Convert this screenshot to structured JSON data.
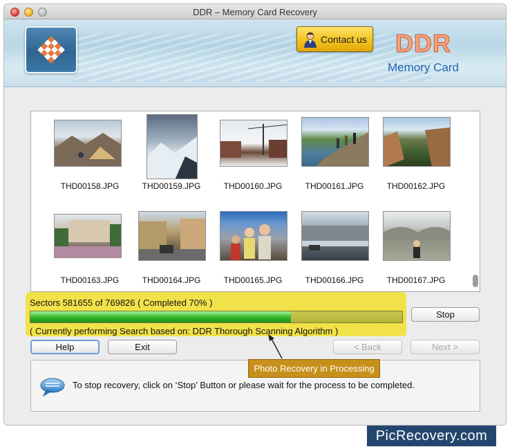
{
  "window": {
    "title": "DDR – Memory Card Recovery"
  },
  "header": {
    "contact_label": "Contact us",
    "brand_title": "DDR",
    "brand_subtitle": "Memory Card"
  },
  "gallery": {
    "items": [
      {
        "name": "THD00158.JPG",
        "photo": "mountain-tent"
      },
      {
        "name": "THD00159.JPG",
        "photo": "snowy-mountain"
      },
      {
        "name": "THD00160.JPG",
        "photo": "ski-lift"
      },
      {
        "name": "THD00161.JPG",
        "photo": "hikers-river"
      },
      {
        "name": "THD00162.JPG",
        "photo": "canyon-cliffs"
      },
      {
        "name": "THD00163.JPG",
        "photo": "crowd-plaza"
      },
      {
        "name": "THD00164.JPG",
        "photo": "street-buildings"
      },
      {
        "name": "THD00165.JPG",
        "photo": "family-portrait"
      },
      {
        "name": "THD00166.JPG",
        "photo": "city-river"
      },
      {
        "name": "THD00167.JPG",
        "photo": "girl-bridge"
      }
    ]
  },
  "status": {
    "sectors_text": "Sectors 581655 of 769826   ( Completed 70% )",
    "progress_percent": 70,
    "algorithm_text": "( Currently performing Search based on: DDR Thorough Scanning Algorithm )"
  },
  "buttons": {
    "stop": "Stop",
    "help": "Help",
    "exit": "Exit",
    "back": "< Back",
    "next": "Next >"
  },
  "callout": {
    "text": "Photo Recovery in Processing"
  },
  "info": {
    "message": "To stop recovery, click on ‘Stop’ Button or please wait for the process to be completed."
  },
  "watermark": {
    "text": "PicRecovery.com"
  },
  "colors": {
    "status_highlight": "#f2e24a",
    "progress_green": "#35b62b",
    "callout_bg": "#c7901a",
    "watermark_bg": "#23466e",
    "brand_orange": "#f5a37d",
    "brand_blue": "#1f63b4"
  }
}
